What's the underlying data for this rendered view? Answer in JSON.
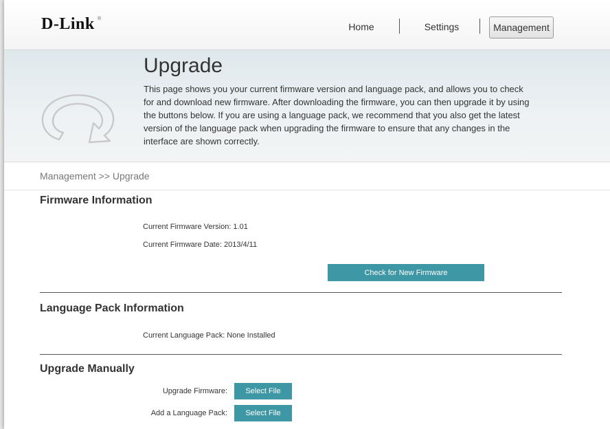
{
  "header": {
    "logo": "D-Link",
    "logo_mark": "®",
    "nav": {
      "home": "Home",
      "settings": "Settings",
      "management": "Management"
    }
  },
  "hero": {
    "icon": "upgrade-arrow-icon",
    "title": "Upgrade",
    "description": "This page shows you your current firmware version and language pack, and allows you to check for and download new firmware. After downloading the firmware, you can then upgrade it by using the buttons below. If you are using a language pack, we recommend that you also get the latest version of the language pack when upgrading the firmware to ensure that any changes in the interface are shown correctly."
  },
  "breadcrumb": "Management >> Upgrade",
  "firmware": {
    "title": "Firmware Information",
    "version": "Current Firmware Version: 1.01",
    "date": "Current Firmware Date: 2013/4/11",
    "check_button": "Check for New Firmware"
  },
  "language": {
    "title": "Language Pack Information",
    "current": "Current Language Pack: None Installed"
  },
  "manual": {
    "title": "Upgrade Manually",
    "firmware_label": "Upgrade Firmware:",
    "firmware_button": "Select File",
    "language_label": "Add a Language Pack:",
    "language_button": "Select File"
  },
  "colors": {
    "accent": "#3e97a4",
    "hero_bg": "#e6ecef"
  }
}
